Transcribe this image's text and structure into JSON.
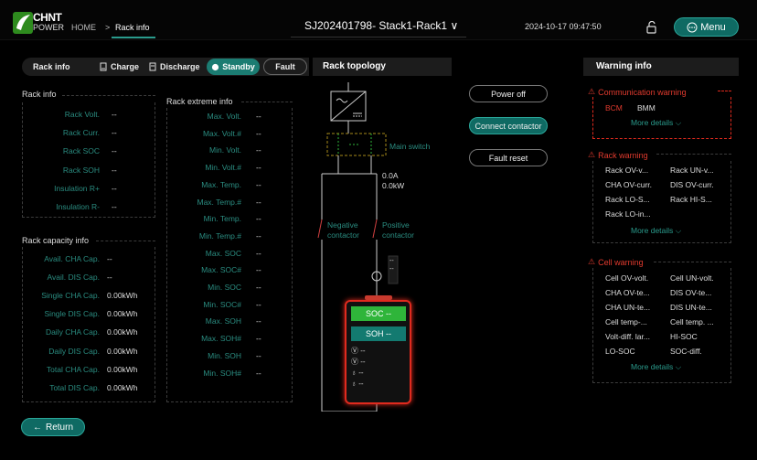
{
  "brand": {
    "name": "CHNT",
    "sub": "POWER"
  },
  "breadcrumb": {
    "home": "HOME",
    "sep": ">",
    "current": "Rack info"
  },
  "device": {
    "selected": "SJ202401798- Stack1-Rack1",
    "chevron": "∨"
  },
  "datetime": "2024-10-17 09:47:50",
  "menu": {
    "label": "Menu"
  },
  "tabs": {
    "rack_info": "Rack info",
    "charge": "Charge",
    "discharge": "Discharge",
    "standby": "Standby",
    "fault": "Fault",
    "selected": "Standby"
  },
  "rack_info": {
    "title": "Rack info",
    "rows": [
      {
        "label": "Rack Volt.",
        "value": "--"
      },
      {
        "label": "Rack Curr.",
        "value": "--"
      },
      {
        "label": "Rack SOC",
        "value": "--"
      },
      {
        "label": "Rack SOH",
        "value": "--"
      },
      {
        "label": "Insulation R+",
        "value": "--"
      },
      {
        "label": "Insulation R-",
        "value": "--"
      }
    ]
  },
  "rack_capacity": {
    "title": "Rack capacity info",
    "rows": [
      {
        "label": "Avail. CHA Cap.",
        "value": "--"
      },
      {
        "label": "Avail. DIS Cap.",
        "value": "--"
      },
      {
        "label": "Single CHA Cap.",
        "value": "0.00kWh"
      },
      {
        "label": "Single DIS Cap.",
        "value": "0.00kWh"
      },
      {
        "label": "Daily CHA Cap.",
        "value": "0.00kWh"
      },
      {
        "label": "Daily DIS Cap.",
        "value": "0.00kWh"
      },
      {
        "label": "Total CHA Cap.",
        "value": "0.00kWh"
      },
      {
        "label": "Total DIS Cap.",
        "value": "0.00kWh"
      }
    ]
  },
  "rack_extreme": {
    "title": "Rack extreme info",
    "rows": [
      {
        "label": "Max. Volt.",
        "value": "--"
      },
      {
        "label": "Max. Volt.#",
        "value": "--"
      },
      {
        "label": "Min. Volt.",
        "value": "--"
      },
      {
        "label": "Min. Volt.#",
        "value": "--"
      },
      {
        "label": "Max. Temp.",
        "value": "--"
      },
      {
        "label": "Max. Temp.#",
        "value": "--"
      },
      {
        "label": "Min. Temp.",
        "value": "--"
      },
      {
        "label": "Min. Temp.#",
        "value": "--"
      },
      {
        "label": "Max. SOC",
        "value": "--"
      },
      {
        "label": "Max. SOC#",
        "value": "--"
      },
      {
        "label": "Min. SOC",
        "value": "--"
      },
      {
        "label": "Min. SOC#",
        "value": "--"
      },
      {
        "label": "Max. SOH",
        "value": "--"
      },
      {
        "label": "Max. SOH#",
        "value": "--"
      },
      {
        "label": "Min. SOH",
        "value": "--"
      },
      {
        "label": "Min. SOH#",
        "value": "--"
      }
    ]
  },
  "topology": {
    "title": "Rack topology",
    "main_switch": "Main switch",
    "current": "0.0A",
    "power": "0.0kW",
    "neg_contactor": [
      "Negative",
      "contactor"
    ],
    "pos_contactor": [
      "Positive",
      "contactor"
    ],
    "soc": "SOC --",
    "soh": "SOH --",
    "cell_rows": [
      "--",
      "--",
      "--",
      "--"
    ],
    "fuse_marks": [
      "--",
      "--"
    ]
  },
  "actions": {
    "power_off": "Power off",
    "connect": "Connect contactor",
    "fault_reset": "Fault reset"
  },
  "warning_info": {
    "title": "Warning info",
    "comm": {
      "title": "Communication warning",
      "items": [
        "BCM",
        "BMM"
      ],
      "more": "More details"
    },
    "rack": {
      "title": "Rack warning",
      "items": [
        "Rack OV-v...",
        "Rack UN-v...",
        "CHA OV-curr.",
        "DIS OV-curr.",
        "Rack LO-S...",
        "Rack HI-S...",
        "Rack LO-in..."
      ],
      "more": "More details"
    },
    "cell": {
      "title": "Cell warning",
      "items": [
        "Cell OV-volt.",
        "Cell UN-volt.",
        "CHA OV-te...",
        "DIS OV-te...",
        "CHA UN-te...",
        "DIS UN-te...",
        "Cell temp-...",
        "Cell temp. ...",
        "Volt-diff. lar...",
        "HI-SOC",
        "LO-SOC",
        "SOC-diff."
      ],
      "more": "More details"
    }
  },
  "return": {
    "label": "Return"
  },
  "colors": {
    "accent": "#2a9b8c",
    "warning": "#e03a2e",
    "soc_green": "#2fb53a",
    "soh_teal": "#137a70"
  }
}
